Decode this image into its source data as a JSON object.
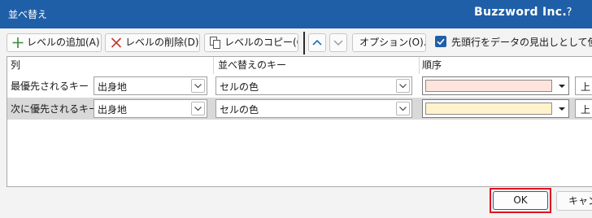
{
  "window": {
    "title": "並べ替え",
    "brand": "Buzzword Inc.",
    "help": "?"
  },
  "toolbar": {
    "add_level": "レベルの追加(A)",
    "delete_level": "レベルの削除(D)",
    "copy_level": "レベルのコピー(C)",
    "move_up_icon": "chevron-up-icon",
    "move_down_icon": "chevron-down-icon",
    "options": "オプション(O)...",
    "has_headers_label": "先頭行をデータの見出しとして使用す",
    "has_headers_checked": true
  },
  "grid": {
    "headers": {
      "column": "列",
      "sort_on": "並べ替えのキー",
      "order": "順序"
    },
    "rows": [
      {
        "label": "最優先されるキー",
        "column": "出身地",
        "sort_on": "セルの色",
        "color": "#fde4dc",
        "order": "上"
      },
      {
        "label": "次に優先されるキー",
        "column": "出身地",
        "sort_on": "セルの色",
        "color": "#fff3cc",
        "order": "上"
      }
    ]
  },
  "footer": {
    "ok": "OK",
    "cancel": "キャンセル"
  },
  "colors": {
    "titlebar": "#1f5fa8",
    "highlight_frame": "#e0141e",
    "add_icon": "#3a8a3a",
    "delete_icon": "#c0392b",
    "chevron": "#1f6fb5"
  }
}
